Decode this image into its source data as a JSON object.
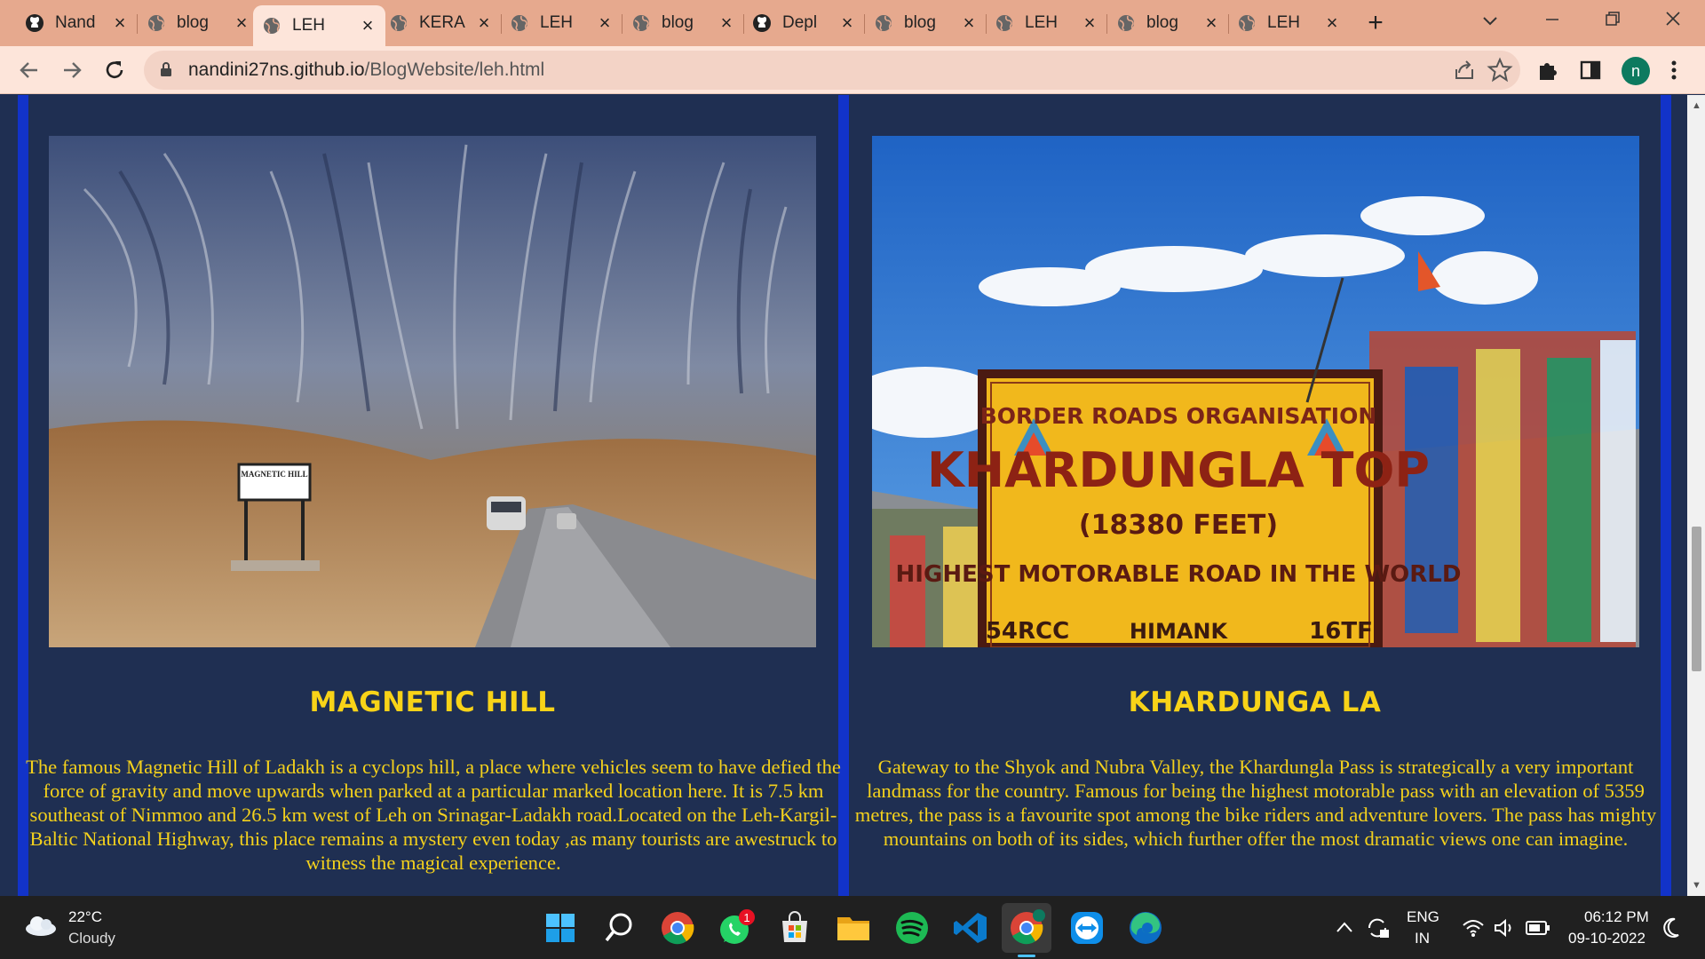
{
  "browser": {
    "tabs": [
      {
        "title": "Nand",
        "icon": "github-icon"
      },
      {
        "title": "blog",
        "icon": "globe-icon"
      },
      {
        "title": "LEH",
        "icon": "globe-icon",
        "active": true
      },
      {
        "title": "KERA",
        "icon": "globe-icon"
      },
      {
        "title": "LEH",
        "icon": "globe-icon"
      },
      {
        "title": "blog",
        "icon": "globe-icon"
      },
      {
        "title": "Depl",
        "icon": "github-icon"
      },
      {
        "title": "blog",
        "icon": "globe-icon"
      },
      {
        "title": "LEH",
        "icon": "globe-icon"
      },
      {
        "title": "blog",
        "icon": "globe-icon"
      },
      {
        "title": "LEH",
        "icon": "globe-icon"
      }
    ],
    "url_domain": "nandini27ns.github.io",
    "url_path": "/BlogWebsite/leh.html",
    "profile_initial": "n"
  },
  "cards": [
    {
      "title": "MAGNETIC HILL",
      "text": "The famous Magnetic Hill of Ladakh is a cyclops hill, a place where vehicles seem to have defied the force of gravity and move upwards when parked at a particular marked location here. It is 7.5 km southeast of Nimmoo and 26.5 km west of Leh on Srinagar-Ladakh road.Located on the Leh-Kargil-Baltic National Highway, this place remains a mystery even today ,as many tourists are awestruck to witness the magical experience.",
      "sign_text": "MAGNETIC HILL"
    },
    {
      "title": "KHARDUNGA LA",
      "text": "Gateway to the Shyok and Nubra Valley, the Khardungla Pass is strategically a very important landmass for the country. Famous for being the highest motorable pass with an elevation of 5359 metres, the pass is a favourite spot among the bike riders and adventure lovers. The pass has mighty mountains on both of its sides, which further offer the most dramatic views one can imagine.",
      "sign_lines": [
        "BORDER ROADS ORGANISATION",
        "KHARDUNGLA TOP",
        "(18380 FEET)",
        "HIGHEST MOTORABLE ROAD IN THE WORLD",
        "54RCC",
        "HIMANK",
        "16TF"
      ]
    }
  ],
  "taskbar": {
    "weather_temp": "22°C",
    "weather_desc": "Cloudy",
    "whatsapp_badge": "1",
    "lang_line1": "ENG",
    "lang_line2": "IN",
    "time": "06:12 PM",
    "date": "09-10-2022"
  }
}
